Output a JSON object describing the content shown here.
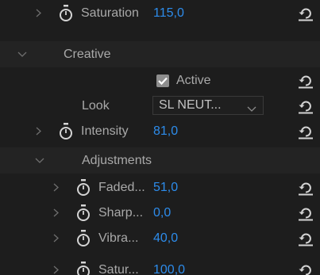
{
  "rows": {
    "saturation": {
      "label": "Saturation",
      "value": "115,0"
    },
    "creative": {
      "label": "Creative"
    },
    "active": {
      "label": "Active",
      "checked": true
    },
    "look": {
      "label": "Look",
      "selected": "SL NEUT..."
    },
    "intensity": {
      "label": "Intensity",
      "value": "81,0"
    },
    "adjustments": {
      "label": "Adjustments"
    },
    "faded": {
      "label": "Faded...",
      "value": "51,0"
    },
    "sharp": {
      "label": "Sharp...",
      "value": "0,0"
    },
    "vibra": {
      "label": "Vibra...",
      "value": "40,0"
    },
    "satur": {
      "label": "Satur...",
      "value": "100,0"
    }
  },
  "icons": {
    "expand": "chevron-right-icon",
    "collapse": "chevron-down-icon",
    "keyframe": "stopwatch-icon",
    "reset": "reset-icon",
    "check": "checkmark-icon",
    "dropdown": "chevron-down-icon"
  },
  "colors": {
    "background": "#1d1d1d",
    "value_blue": "#2d8ceb",
    "label_gray": "#a9a9a9"
  }
}
